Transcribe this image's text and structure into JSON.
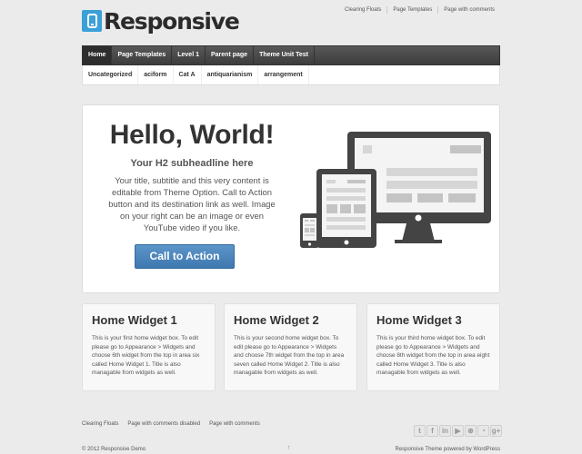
{
  "site": {
    "title": "Responsive",
    "logo_icon": "tablet-icon"
  },
  "top_menu": [
    "Clearing Floats",
    "Page Templates",
    "Page with comments"
  ],
  "main_nav": [
    {
      "label": "Home",
      "active": true
    },
    {
      "label": "Page Templates",
      "active": false
    },
    {
      "label": "Level 1",
      "active": false
    },
    {
      "label": "Parent page",
      "active": false
    },
    {
      "label": "Theme Unit Test",
      "active": false
    }
  ],
  "sub_nav": [
    "Uncategorized",
    "aciform",
    "Cat A",
    "antiquarianism",
    "arrangement"
  ],
  "featured": {
    "title": "Hello, World!",
    "subtitle": "Your H2 subheadline here",
    "text": "Your title, subtitle and this very content is editable from Theme Option. Call to Action button and its destination link as well. Image on your right can be an image or even YouTube video if you like.",
    "cta_label": "Call to Action",
    "image": "responsive-devices-illustration",
    "colors": {
      "cta": "#4a86bd",
      "device": "#444444"
    }
  },
  "widgets": [
    {
      "title": "Home Widget 1",
      "text": "This is your first home widget box. To edit please go to Appearance > Widgets and choose 6th widget from the top in area six called Home Widget 1. Title is also managable from widgets as well."
    },
    {
      "title": "Home Widget 2",
      "text": "This is your second home widget box. To edit please go to Appearance > Widgets and choose 7th widget from the top in area seven called Home Widget 2. Title is also managable from widgets as well."
    },
    {
      "title": "Home Widget 3",
      "text": "This is your third home widget box. To edit please go to Appearance > Widgets and choose 8th widget from the top in area eight called Home Widget 3. Title is also managable from widgets as well."
    }
  ],
  "footer": {
    "menu": [
      "Clearing Floats",
      "Page with comments disabled",
      "Page with comments"
    ],
    "social": [
      {
        "icon": "twitter-icon",
        "glyph": "t"
      },
      {
        "icon": "facebook-icon",
        "glyph": "f"
      },
      {
        "icon": "linkedin-icon",
        "glyph": "in"
      },
      {
        "icon": "youtube-icon",
        "glyph": "▶"
      },
      {
        "icon": "stumbleupon-icon",
        "glyph": "⊛"
      },
      {
        "icon": "rss-icon",
        "glyph": "◔"
      },
      {
        "icon": "google-plus-icon",
        "glyph": "g+"
      }
    ],
    "copyright": "© 2012 Responsive Demo",
    "scroll_top": "↑",
    "powered_by": "Responsive Theme powered by WordPress"
  }
}
